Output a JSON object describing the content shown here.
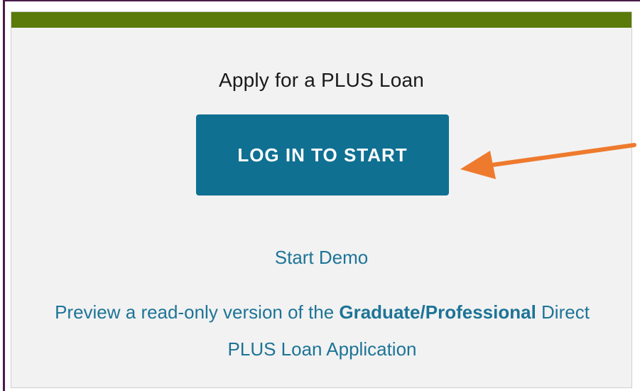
{
  "panel": {
    "heading": "Apply for a PLUS Loan",
    "login_button_label": "LOG IN TO START",
    "demo_link_label": "Start Demo",
    "preview": {
      "prefix": "Preview a read-only version of the ",
      "emphasis": "Graduate/Professional",
      "suffix": " Direct PLUS Loan Application"
    }
  },
  "colors": {
    "top_bar": "#5a7a0a",
    "button": "#0f7092",
    "link": "#1d7497",
    "arrow": "#ee7a2e",
    "frame_border": "#4a1a4a"
  }
}
